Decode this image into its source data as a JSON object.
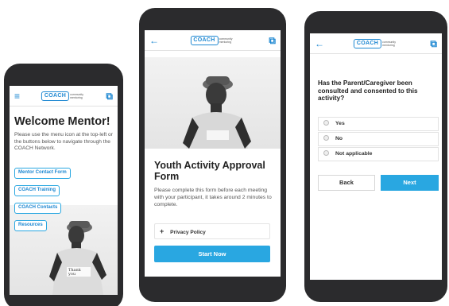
{
  "logo": {
    "name": "COACH",
    "sub": "community mentoring"
  },
  "phone1": {
    "menu_icon": "≡",
    "share_icon": "⧉",
    "title": "Welcome Mentor!",
    "intro": "Please use the menu icon at the top-left or the buttons below to navigate through the COACH Network.",
    "buttons": [
      "Mentor Contact Form",
      "COACH Training",
      "COACH Contacts",
      "Resources"
    ],
    "shirt_text": "Thank you"
  },
  "phone2": {
    "back_icon": "←",
    "share_icon": "⧉",
    "title": "Youth Activity Approval Form",
    "description": "Please complete this form before each meeting with your participant, it takes around 2 minutes to complete.",
    "privacy_label": "Privacy Policy",
    "privacy_icon": "+",
    "start_label": "Start Now"
  },
  "phone3": {
    "back_icon": "←",
    "share_icon": "⧉",
    "question": "Has the Parent/Caregiver been consulted and consented to this activity?",
    "options": [
      "Yes",
      "No",
      "Not applicable"
    ],
    "back_label": "Back",
    "next_label": "Next"
  },
  "colors": {
    "accent": "#29a7e1",
    "brand": "#1e88d2",
    "phone_frame": "#2b2b2d"
  }
}
